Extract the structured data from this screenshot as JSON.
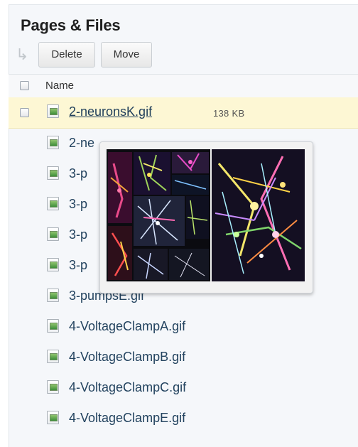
{
  "panel": {
    "title": "Pages & Files",
    "toolbar": {
      "delete_label": "Delete",
      "move_label": "Move"
    },
    "table": {
      "header_name": "Name"
    }
  },
  "files": [
    {
      "name": "2-neuronsK.gif",
      "size": "138 KB"
    },
    {
      "name": "2-ne"
    },
    {
      "name": "3-p"
    },
    {
      "name": "3-p"
    },
    {
      "name": "3-p"
    },
    {
      "name": "3-p"
    },
    {
      "name": "3-pumpsE.gif"
    },
    {
      "name": "4-VoltageClampA.gif"
    },
    {
      "name": "4-VoltageClampB.gif"
    },
    {
      "name": "4-VoltageClampC.gif"
    },
    {
      "name": "4-VoltageClampE.gif"
    }
  ],
  "colors": {
    "highlight": "#fdf7d4",
    "link": "#23435f",
    "panel_bg": "#f5f7fa"
  },
  "icons": [
    "undo-arrow-icon",
    "checkbox",
    "gif-file-icon"
  ]
}
